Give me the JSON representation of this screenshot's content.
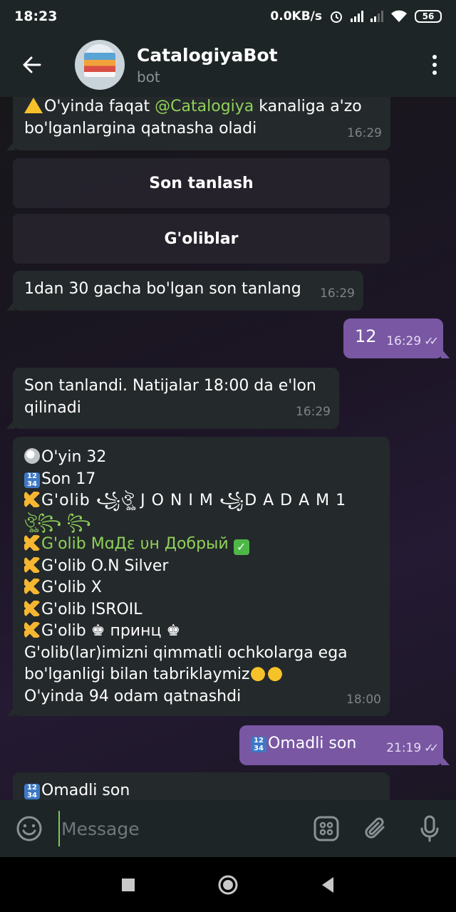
{
  "status_bar": {
    "time": "18:23",
    "net_speed": "0.0KB/s",
    "battery": "56"
  },
  "header": {
    "title": "CatalogiyaBot",
    "subtitle": "bot",
    "avatar_icon": "catalog-book-icon"
  },
  "messages": {
    "m1": {
      "line1_pre": "O'yinda faqat ",
      "mention": "@Catalogiya",
      "line1_post": " kanaliga a'zo",
      "line2": "bo'lganlargina qatnasha oladi",
      "time": "16:29"
    },
    "keyboard": {
      "btn1": "Son tanlash",
      "btn2": "G'oliblar"
    },
    "m2": {
      "text": "1dan 30 gacha bo'lgan son tanlang",
      "time": "16:29"
    },
    "m3": {
      "text": "12",
      "time": "16:29"
    },
    "m4": {
      "line1": "Son tanlandi. Natijalar 18:00 da e'lon",
      "line2": "qilinadi",
      "time": "16:29"
    },
    "m5": {
      "line1": "O'yin 32",
      "line2": "Son 17",
      "winner1": "G'olib ꧁ঔৣ J O N I M ꧁D A D A M 1",
      "winner1b": "ঔৣ꧂ ꧂",
      "winner2": "G'olib МɑДε υн Добрый",
      "winner3": "G'olib O.N Silver",
      "winner4": "G'olib X",
      "winner5": "G'olib ISROIL",
      "winner6": "G'olib ♚ принц ♚",
      "congrats1": "G'olib(lar)imizni qimmatli ochkolarga ega",
      "congrats2": "bo'lganligi bilan tabriklaymiz",
      "participants": "O'yinda 94 odam qatnashdi",
      "time": "18:00"
    },
    "m6": {
      "text": "Omadli son",
      "time": "21:19"
    },
    "m7": {
      "text": "Omadli son"
    }
  },
  "input": {
    "placeholder": "Message"
  },
  "colors": {
    "accent_out": "#7957a3",
    "bubble_in": "#24292b",
    "mention": "#8fd15a"
  }
}
